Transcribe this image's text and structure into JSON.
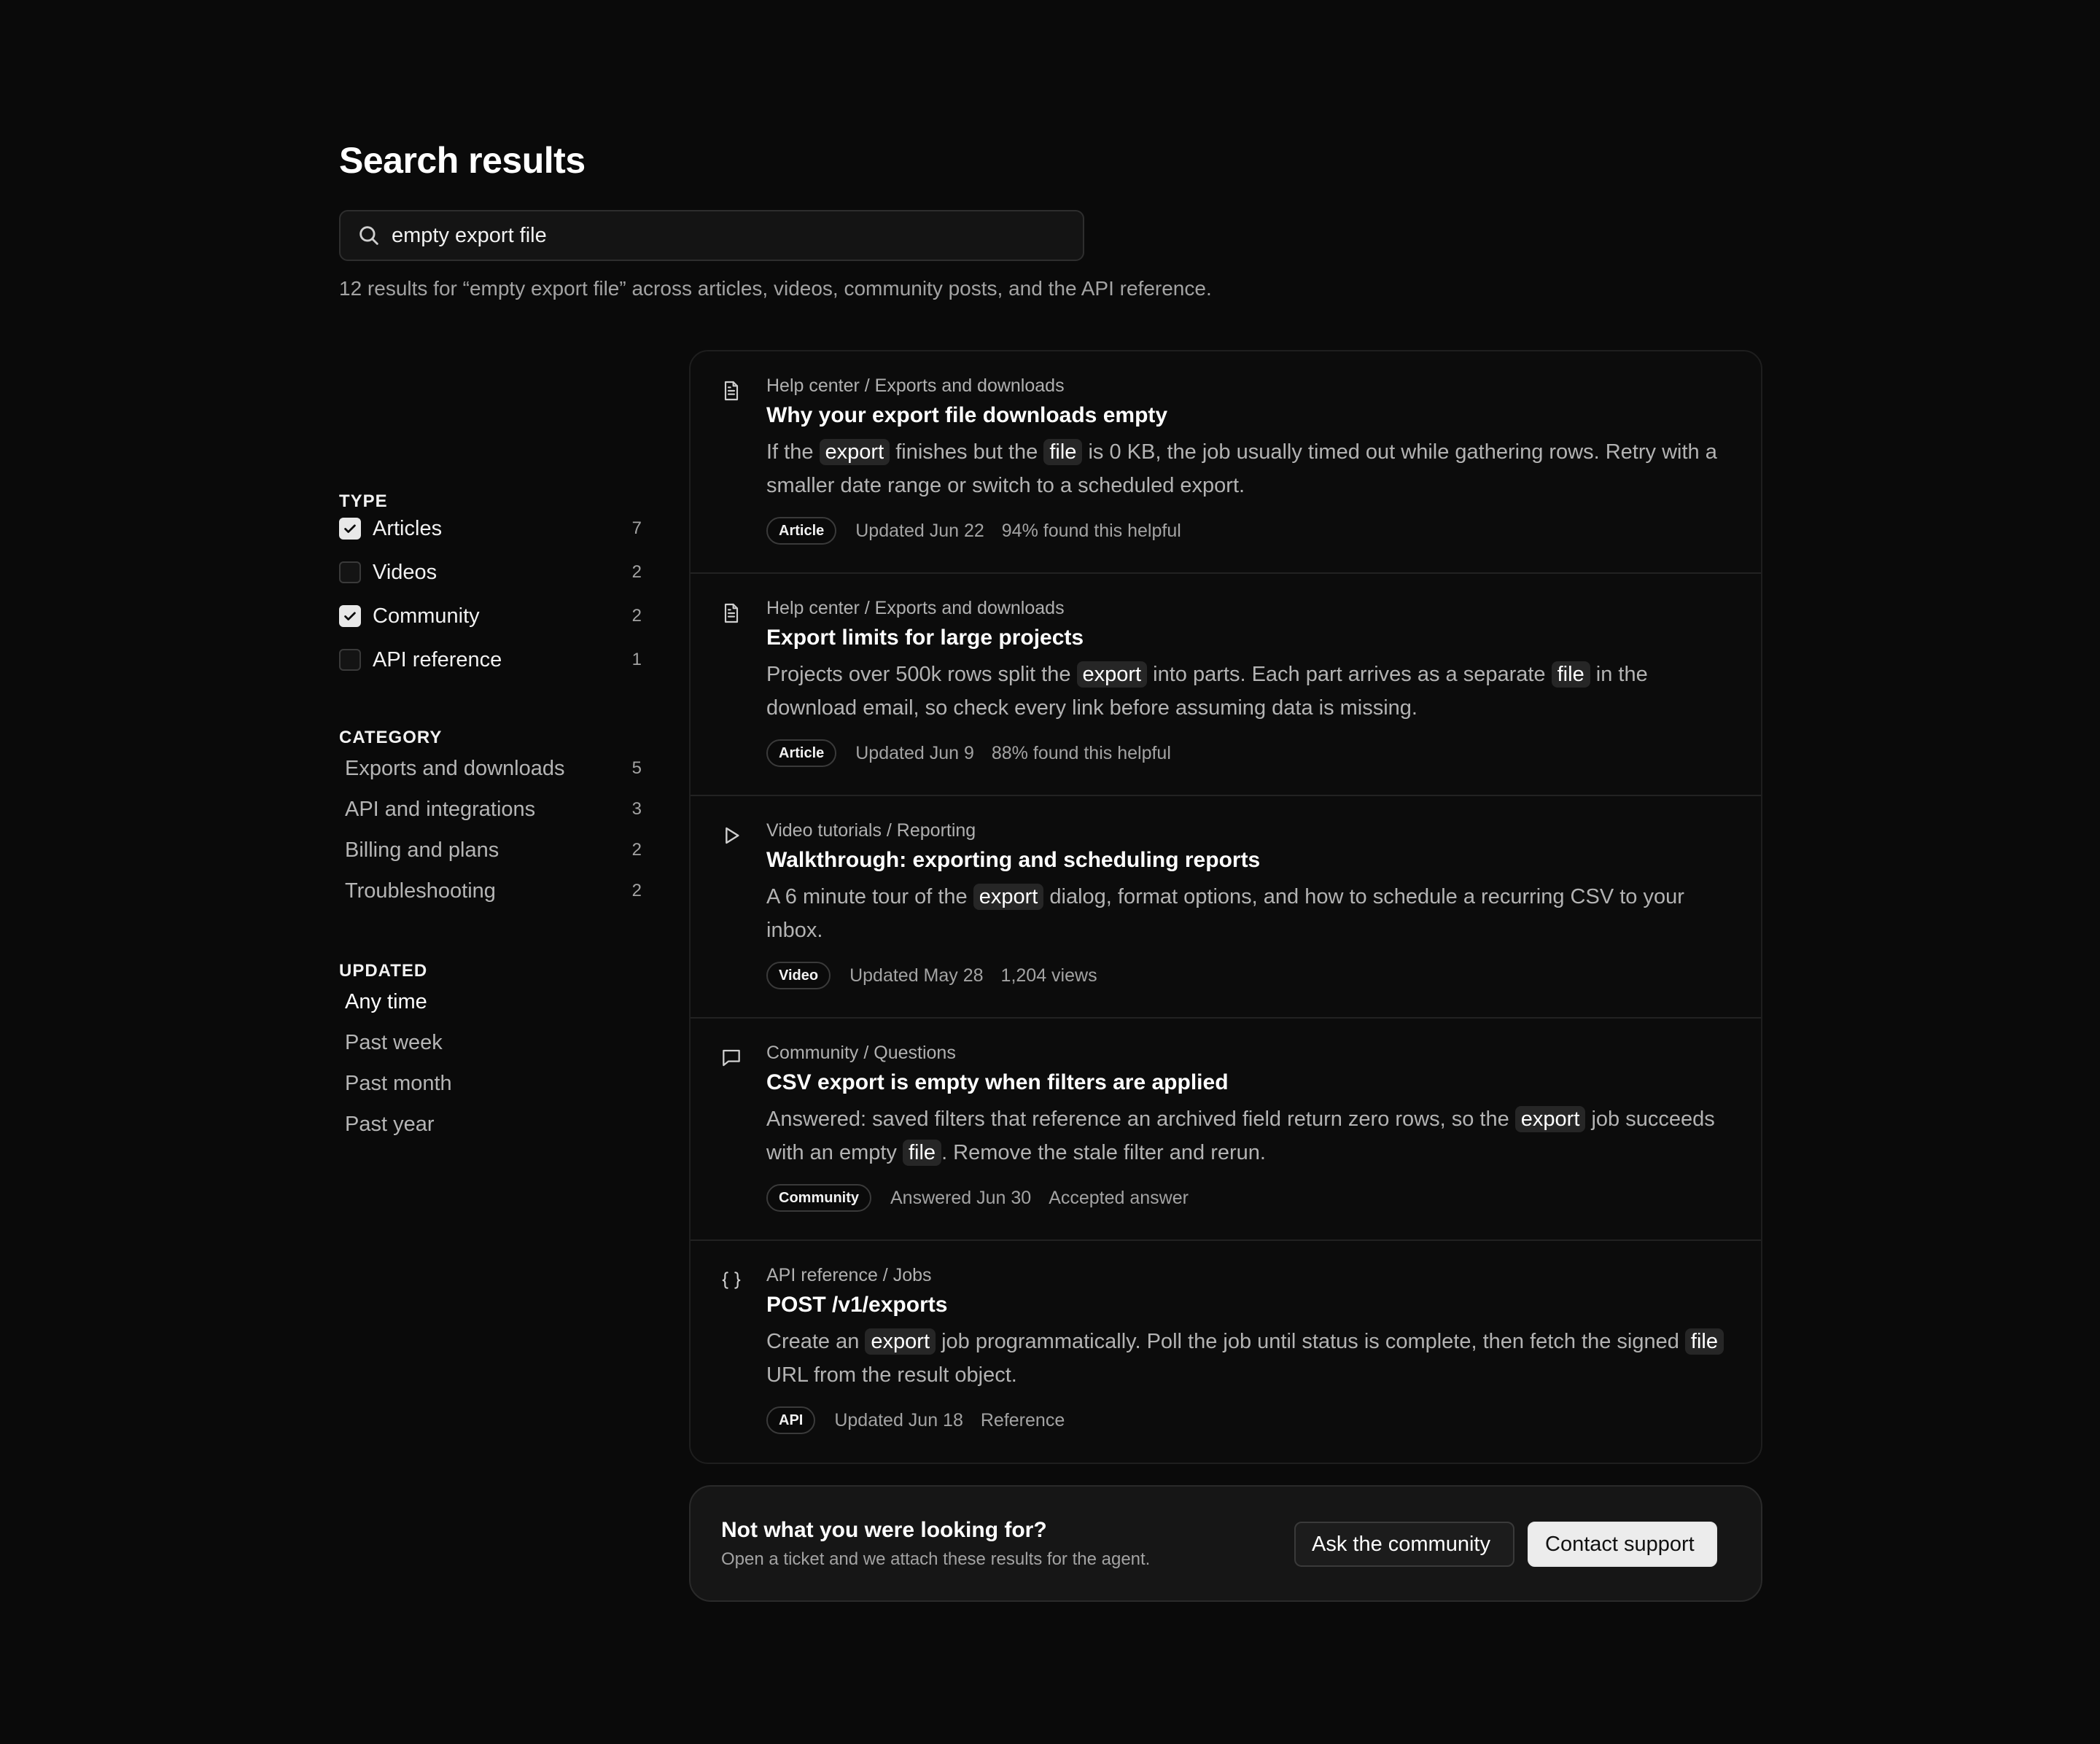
{
  "page_title": "Search results",
  "search": {
    "value": "empty export file",
    "placeholder": "Search"
  },
  "summary": "12 results for “empty export file” across articles, videos, community posts, and the API reference.",
  "filters": {
    "type_heading": "TYPE",
    "types": [
      {
        "label": "Articles",
        "count": "7",
        "checked": true
      },
      {
        "label": "Videos",
        "count": "2",
        "checked": false
      },
      {
        "label": "Community",
        "count": "2",
        "checked": true
      },
      {
        "label": "API reference",
        "count": "1",
        "checked": false
      }
    ],
    "category_heading": "CATEGORY",
    "categories": [
      {
        "label": "Exports and downloads",
        "count": "5"
      },
      {
        "label": "API and integrations",
        "count": "3"
      },
      {
        "label": "Billing and plans",
        "count": "2"
      },
      {
        "label": "Troubleshooting",
        "count": "2"
      }
    ],
    "updated_heading": "UPDATED",
    "updated_options": [
      {
        "label": "Any time",
        "active": true
      },
      {
        "label": "Past week",
        "active": false
      },
      {
        "label": "Past month",
        "active": false
      },
      {
        "label": "Past year",
        "active": false
      }
    ]
  },
  "results": [
    {
      "icon": "document-icon",
      "breadcrumb": "Help center / Exports and downloads",
      "title": "Why your export file downloads empty",
      "snippet": [
        {
          "t": "If the "
        },
        {
          "t": "export",
          "hl": true
        },
        {
          "t": " finishes but the "
        },
        {
          "t": "file",
          "hl": true
        },
        {
          "t": " is 0 KB, the job usually timed out while gathering rows. Retry with a smaller date range or switch to a scheduled export."
        }
      ],
      "badge": "Article",
      "meta1": "Updated Jun 22",
      "meta2": "94% found this helpful"
    },
    {
      "icon": "document-icon",
      "breadcrumb": "Help center / Exports and downloads",
      "title": "Export limits for large projects",
      "snippet": [
        {
          "t": "Projects over 500k rows split the "
        },
        {
          "t": "export",
          "hl": true
        },
        {
          "t": " into parts. Each part arrives as a separate "
        },
        {
          "t": "file",
          "hl": true
        },
        {
          "t": " in the download email, so check every link before assuming data is missing."
        }
      ],
      "badge": "Article",
      "meta1": "Updated Jun 9",
      "meta2": "88% found this helpful"
    },
    {
      "icon": "play-icon",
      "breadcrumb": "Video tutorials / Reporting",
      "title": "Walkthrough: exporting and scheduling reports",
      "snippet": [
        {
          "t": "A 6 minute tour of the "
        },
        {
          "t": "export",
          "hl": true
        },
        {
          "t": " dialog, format options, and how to schedule a recurring CSV to your inbox."
        }
      ],
      "badge": "Video",
      "meta1": "Updated May 28",
      "meta2": "1,204 views"
    },
    {
      "icon": "chat-bubble-icon",
      "breadcrumb": "Community / Questions",
      "title": "CSV export is empty when filters are applied",
      "snippet": [
        {
          "t": "Answered: saved filters that reference an archived field return zero rows, so the "
        },
        {
          "t": "export",
          "hl": true
        },
        {
          "t": " job succeeds with an empty "
        },
        {
          "t": "file",
          "hl": true
        },
        {
          "t": ". Remove the stale filter and rerun."
        }
      ],
      "badge": "Community",
      "meta1": "Answered Jun 30",
      "meta2": "Accepted answer"
    },
    {
      "icon": "code-braces-icon",
      "breadcrumb": "API reference / Jobs",
      "title": "POST /v1/exports",
      "snippet": [
        {
          "t": "Create an "
        },
        {
          "t": "export",
          "hl": true
        },
        {
          "t": " job programmatically. Poll the job until status is complete, then fetch the signed "
        },
        {
          "t": "file",
          "hl": true
        },
        {
          "t": " URL from the result object."
        }
      ],
      "badge": "API",
      "meta1": "Updated Jun 18",
      "meta2": "Reference"
    }
  ],
  "cta": {
    "title": "Not what you were looking for?",
    "subtitle": "Open a ticket and we attach these results for the agent.",
    "secondary_button": "Ask the community",
    "primary_button": "Contact support"
  }
}
